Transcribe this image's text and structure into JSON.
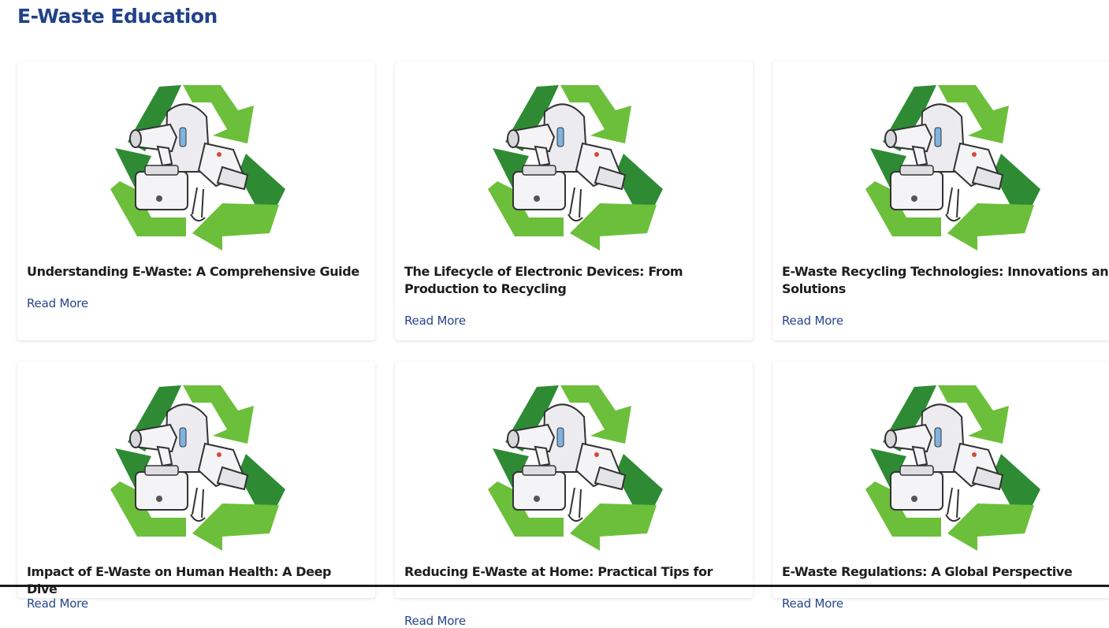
{
  "page": {
    "title": "E-Waste Education"
  },
  "colors": {
    "title": "#22418a",
    "link": "#25478c",
    "recycle_dark": "#2e8b34",
    "recycle_light": "#6cbf3b"
  },
  "cards": [
    {
      "title": "Understanding E-Waste: A Comprehensive Guide",
      "link": "Read More",
      "image_icon": "recycle-electronics-icon"
    },
    {
      "title": "The Lifecycle of Electronic Devices: From Production to Recycling",
      "link": "Read More",
      "image_icon": "recycle-electronics-icon"
    },
    {
      "title": "E-Waste Recycling Technologies: Innovations and Solutions",
      "link": "Read More",
      "image_icon": "recycle-electronics-icon"
    },
    {
      "title": "Impact of E-Waste on Human Health: A Deep Dive",
      "link": "Read More",
      "image_icon": "recycle-electronics-icon"
    },
    {
      "title": "Reducing E-Waste at Home: Practical Tips for",
      "link": "Read More",
      "image_icon": "recycle-electronics-icon"
    },
    {
      "title": "E-Waste Regulations: A Global Perspective",
      "link": "Read More",
      "image_icon": "recycle-electronics-icon"
    }
  ]
}
